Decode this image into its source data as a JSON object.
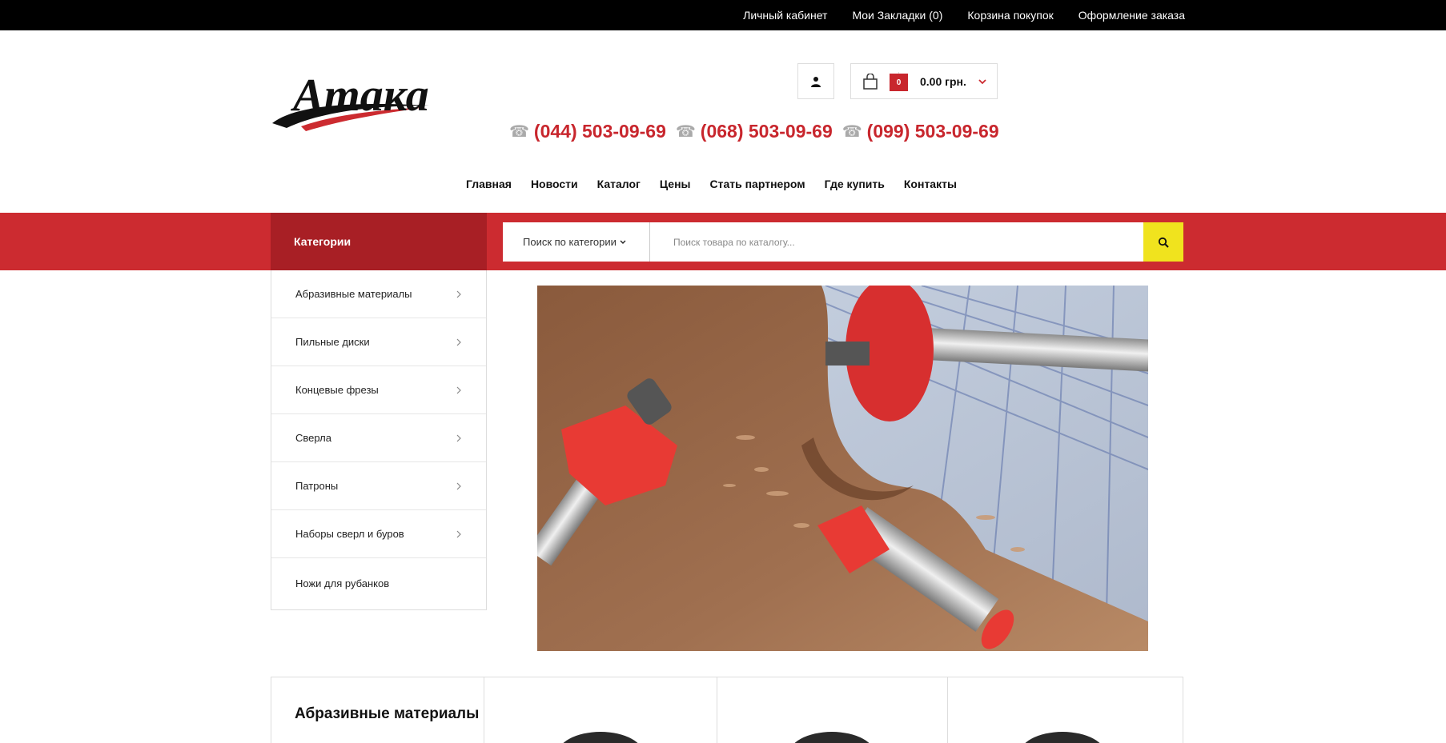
{
  "topbar": {
    "links": [
      "Личный кабинет",
      "Мои Закладки (0)",
      "Корзина покупок",
      "Оформление заказа"
    ]
  },
  "header": {
    "logo_text": "Атака",
    "cart": {
      "count": "0",
      "total": "0.00 грн."
    },
    "phones": [
      "(044) 503-09-69",
      "(068) 503-09-69",
      "(099) 503-09-69"
    ]
  },
  "nav": {
    "items": [
      "Главная",
      "Новости",
      "Каталог",
      "Цены",
      "Стать партнером",
      "Где купить",
      "Контакты"
    ]
  },
  "search": {
    "categories_label": "Категории",
    "category_select": "Поиск по категории",
    "placeholder": "Поиск товара по каталогу..."
  },
  "sidebar": {
    "items": [
      "Абразивные материалы",
      "Пильные диски",
      "Концевые фрезы",
      "Сверла",
      "Патроны",
      "Наборы сверл и буров",
      "Ножи для рубанков"
    ]
  },
  "products": {
    "section_title": "Абразивные материалы"
  },
  "colors": {
    "brand_red": "#cc2b30",
    "dark_red": "#a81f25",
    "search_yellow": "#f0e31e"
  }
}
